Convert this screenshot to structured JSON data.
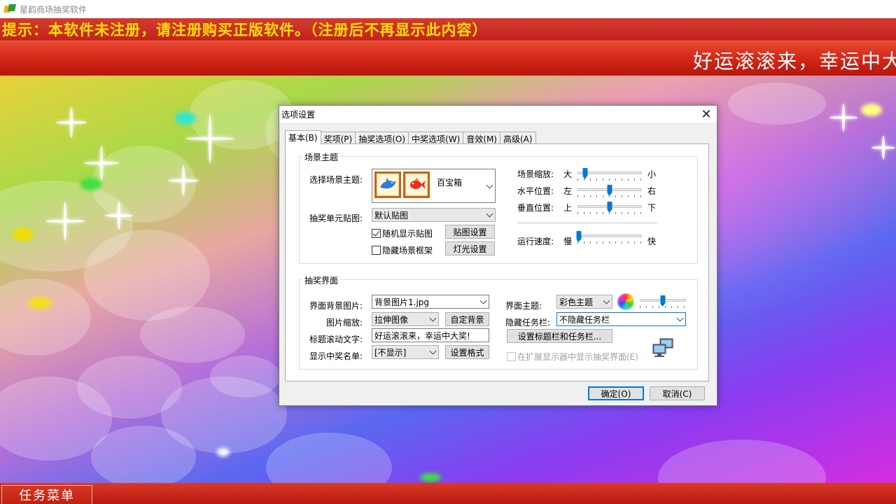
{
  "app": {
    "title": "星韵商场抽奖软件",
    "notice": "提示：本软件未注册，请注册购买正版软件。（注册后不再显示此内容）",
    "marquee": "好运滚滚来，幸运中大"
  },
  "bottom": {
    "task_menu_label": "任务菜单"
  },
  "dialog": {
    "title": "选项设置",
    "close_symbol": "✕",
    "tabs": [
      {
        "label": "基本(B)",
        "active": true
      },
      {
        "label": "奖项(P)"
      },
      {
        "label": "抽奖选项(O)"
      },
      {
        "label": "中奖选项(W)"
      },
      {
        "label": "音效(M)"
      },
      {
        "label": "高级(A)"
      }
    ],
    "scene_group": {
      "title": "场景主题",
      "select_theme_label": "选择场景主题:",
      "theme_value": "百宝箱",
      "cell_image_label": "抽奖单元贴图:",
      "cell_image_value": "默认贴图",
      "random_show_label": "随机显示贴图",
      "random_show_checked": true,
      "hide_frame_label": "隐藏场景框架",
      "hide_frame_checked": false,
      "texture_btn": "贴图设置",
      "light_btn": "灯光设置",
      "sliders": [
        {
          "label": "场景缩放:",
          "min_label": "大",
          "max_label": "小",
          "value": 0.12
        },
        {
          "label": "水平位置:",
          "min_label": "左",
          "max_label": "右",
          "value": 0.5
        },
        {
          "label": "垂直位置:",
          "min_label": "上",
          "max_label": "下",
          "value": 0.5
        }
      ],
      "speed": {
        "label": "运行速度:",
        "min_label": "慢",
        "max_label": "快",
        "value": 0.02
      }
    },
    "ui_group": {
      "title": "抽奖界面",
      "bg_image_label": "界面背景图片:",
      "bg_image_value": "背景图片1.jpg",
      "scale_label": "图片缩放:",
      "scale_value": "拉伸图像",
      "custom_bg_btn": "自定背景",
      "scroll_text_label": "标题滚动文字:",
      "scroll_text_value": "好运滚滚来，幸运中大奖!",
      "winners_label": "显示中奖名单:",
      "winners_value": "[不显示]",
      "format_btn": "设置格式",
      "ui_theme_label": "界面主题:",
      "ui_theme_value": "彩色主题",
      "theme_slider_value": 0.5,
      "hide_taskbar_label": "隐藏任务栏:",
      "hide_taskbar_value": "不隐藏任务栏",
      "set_titlebar_btn": "设置标题栏和任务栏...",
      "extend_display_label": "在扩展显示器中显示抽奖界面(E)",
      "extend_display_checked": false
    },
    "ok_btn": "确定(O)",
    "cancel_btn": "取消(C)"
  },
  "colors": {
    "banner_red": "#c8261c",
    "notice_yellow": "#ffe000",
    "slider_blue": "#0078d7"
  }
}
